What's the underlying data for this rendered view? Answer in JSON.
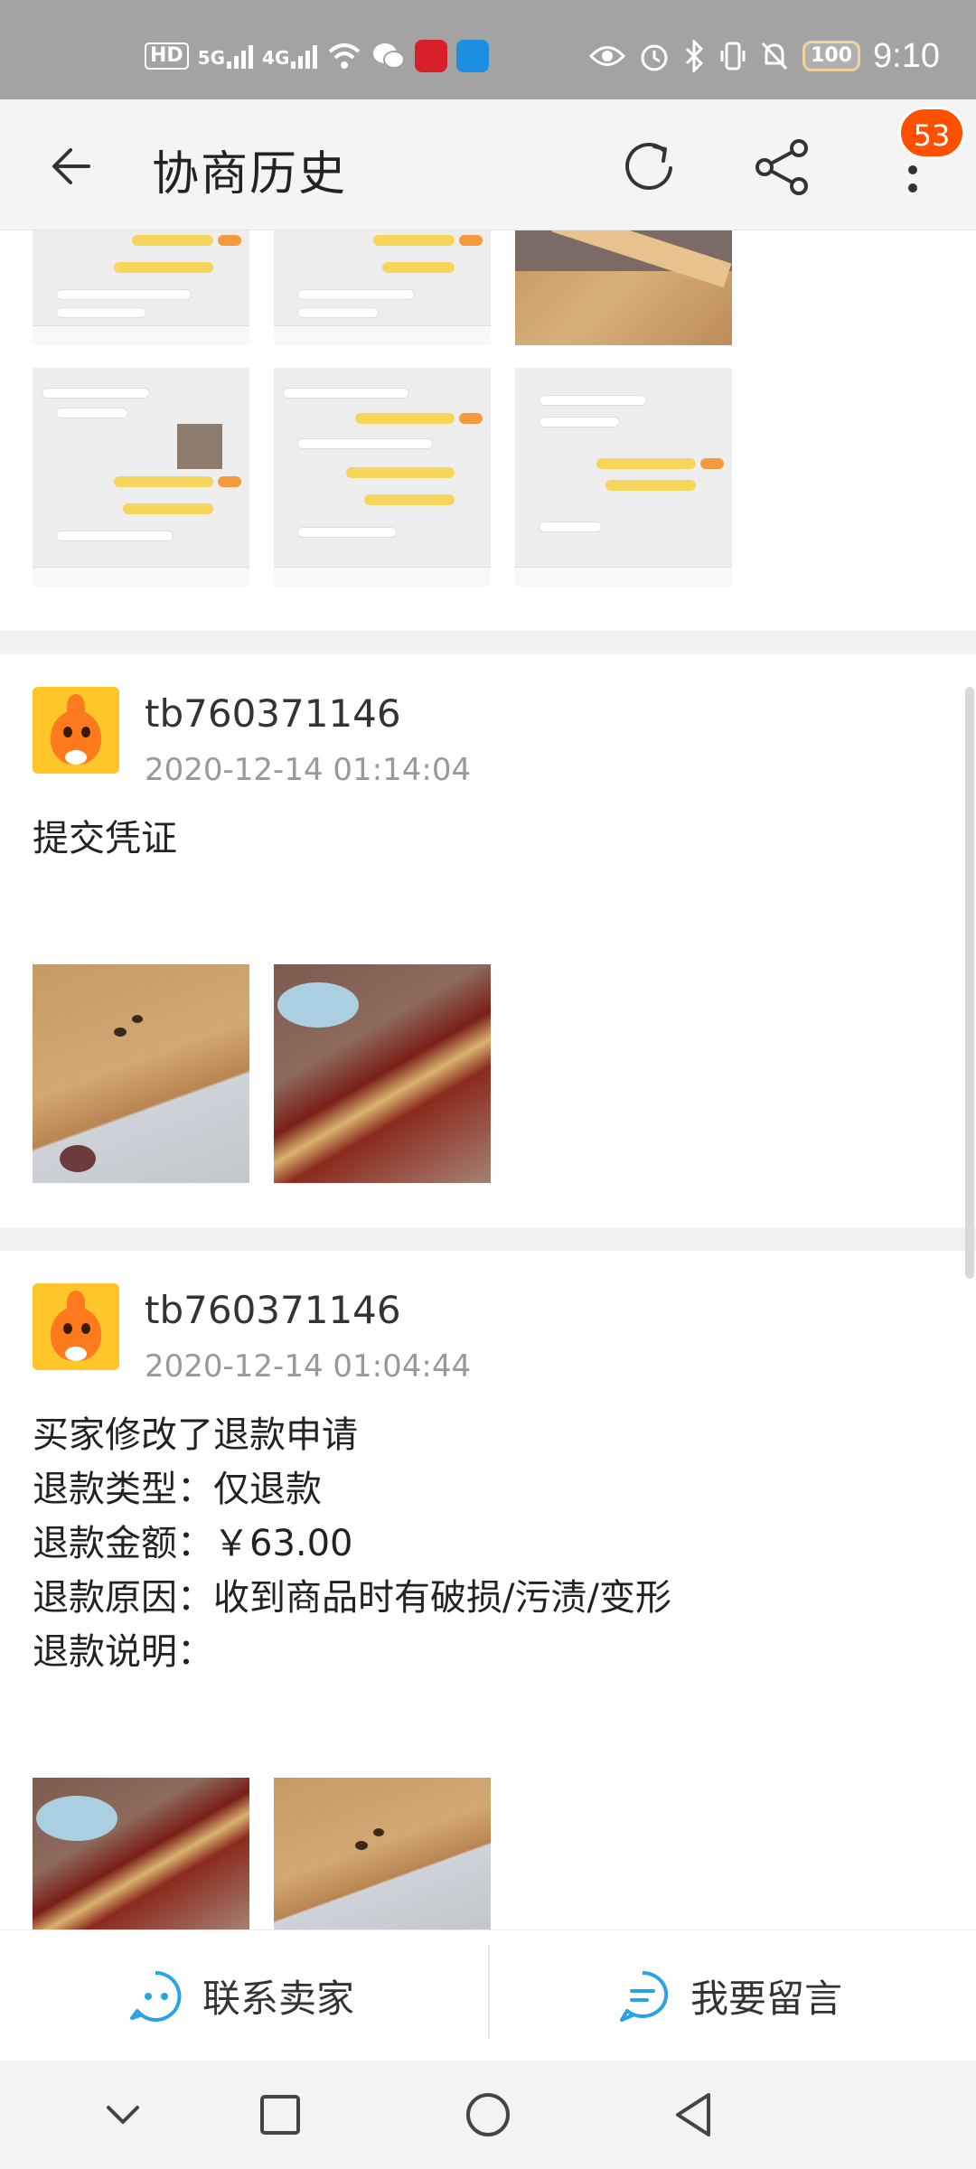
{
  "status_bar": {
    "hd_label": "HD",
    "sim1_label": "5G",
    "sim2_label": "4G",
    "battery": "100",
    "time": "9:10",
    "left_icons": [
      "hd-icon",
      "signal-5g-icon",
      "signal-4g-icon",
      "wifi-icon",
      "wechat-icon",
      "app-red-icon",
      "app-blue-icon"
    ],
    "right_icons": [
      "eye-icon",
      "alarm-icon",
      "bluetooth-icon",
      "vibrate-icon",
      "mute-icon",
      "battery-icon"
    ]
  },
  "header": {
    "title": "协商历史",
    "badge_count": "53",
    "icons": [
      "back-arrow-icon",
      "refresh-icon",
      "share-icon",
      "more-vertical-icon"
    ]
  },
  "records": [
    {
      "images": [
        "chat-screenshot",
        "chat-screenshot",
        "wood-floor-photo",
        "chat-screenshot",
        "chat-screenshot",
        "chat-screenshot"
      ]
    },
    {
      "username": "tb760371146",
      "time": "2020-12-14 01:14:04",
      "text": "提交凭证",
      "images": [
        "wood-board-photo",
        "wood-board-stack-photo"
      ]
    },
    {
      "username": "tb760371146",
      "time": "2020-12-14 01:04:44",
      "lines": [
        "买家修改了退款申请",
        "退款类型：仅退款",
        "退款金额：￥63.00",
        "退款原因：收到商品时有破损/污渍/变形",
        "退款说明："
      ],
      "images": [
        "wood-board-stack-photo",
        "wood-board-photo"
      ]
    }
  ],
  "actions": {
    "contact_seller": "联系卖家",
    "leave_message": "我要留言"
  },
  "navbar": {
    "icons": [
      "nav-collapse-icon",
      "nav-recents-icon",
      "nav-home-icon",
      "nav-back-icon"
    ]
  },
  "colors": {
    "accent_orange": "#ff5000",
    "action_blue": "#2aa3e6",
    "status_bar": "#a3a3a3"
  }
}
